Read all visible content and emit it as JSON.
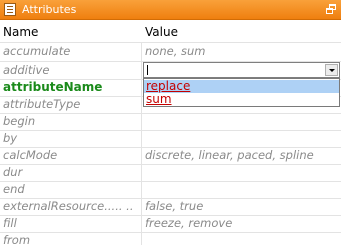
{
  "panel": {
    "title": "Attributes"
  },
  "headers": {
    "name": "Name",
    "value": "Value"
  },
  "rows": [
    {
      "name": "accumulate",
      "value": "none, sum"
    },
    {
      "name": "additive",
      "value": ""
    },
    {
      "name": "attributeName",
      "value": ""
    },
    {
      "name": "attributeType",
      "value": ""
    },
    {
      "name": "begin",
      "value": ""
    },
    {
      "name": "by",
      "value": ""
    },
    {
      "name": "calcMode",
      "value": "discrete, linear, paced, spline"
    },
    {
      "name": "dur",
      "value": ""
    },
    {
      "name": "end",
      "value": ""
    },
    {
      "name": "externalResource..... ..",
      "value": "false, true"
    },
    {
      "name": "fill",
      "value": "freeze, remove"
    },
    {
      "name": "from",
      "value": ""
    }
  ],
  "dropdown": {
    "options": [
      "replace",
      "sum"
    ],
    "selected": "replace"
  }
}
